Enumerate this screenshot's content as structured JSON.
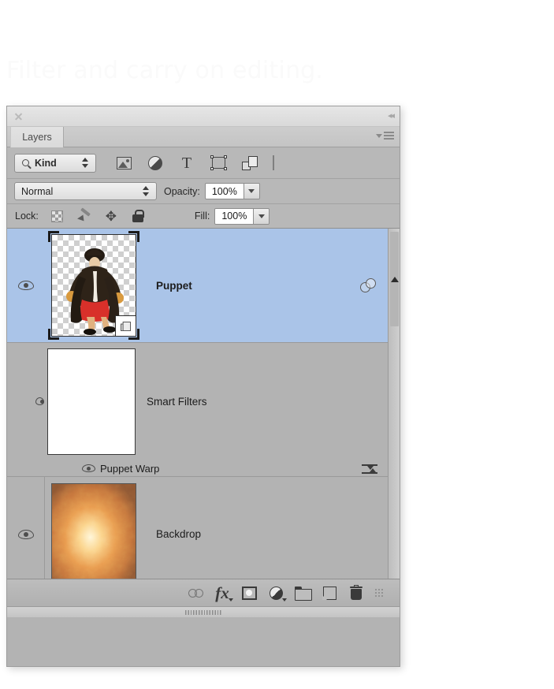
{
  "background_caption": "Filter and carry on editing.",
  "panel": {
    "tab_label": "Layers",
    "titlebar": {
      "close_icon": "close-icon",
      "collapse_icon": "collapse-to-icons-arrows"
    },
    "menu_icon": "panel-menu-icon"
  },
  "filter_bar": {
    "kind_label": "Kind",
    "search_icon": "magnifier-icon",
    "filters": [
      {
        "name": "filter-pixel-layers",
        "icon": "pixel-layer-icon"
      },
      {
        "name": "filter-adjustment-layers",
        "icon": "adjustment-layer-icon"
      },
      {
        "name": "filter-type-layers",
        "icon": "type-layer-icon",
        "glyph": "T"
      },
      {
        "name": "filter-shape-layers",
        "icon": "shape-layer-icon"
      },
      {
        "name": "filter-smart-objects",
        "icon": "smart-object-icon"
      }
    ],
    "toggle_name": "filter-enable-toggle"
  },
  "blend_bar": {
    "blend_mode": "Normal",
    "opacity_label": "Opacity:",
    "opacity_value": "100%"
  },
  "lock_bar": {
    "lock_label": "Lock:",
    "locks": [
      {
        "name": "lock-transparent-pixels",
        "icon": "checkerboard-icon"
      },
      {
        "name": "lock-image-pixels",
        "icon": "brush-icon"
      },
      {
        "name": "lock-position",
        "icon": "move-arrows-icon"
      },
      {
        "name": "lock-all",
        "icon": "lock-icon"
      }
    ],
    "fill_label": "Fill:",
    "fill_value": "100%"
  },
  "layers": [
    {
      "name": "Puppet",
      "selected": true,
      "visible": true,
      "thumbnail": "puppet-character-on-transparent",
      "smart_object_badge": true,
      "smart_filter_icon": "blending-options-icon"
    },
    {
      "name": "Backdrop",
      "selected": false,
      "visible": true,
      "thumbnail": "orange-clouds",
      "smart_object_badge": false
    }
  ],
  "smart_filters": {
    "label": "Smart Filters",
    "visible": true,
    "mask_thumbnail": "white-filter-mask",
    "entries": [
      {
        "label": "Puppet Warp",
        "visible": true,
        "options_icon": "filter-blending-options-icon"
      }
    ]
  },
  "bottom_bar": [
    {
      "name": "link-layers-button",
      "icon": "link-icon"
    },
    {
      "name": "layer-style-button",
      "icon": "fx-icon",
      "glyph": "fx"
    },
    {
      "name": "add-layer-mask-button",
      "icon": "mask-icon"
    },
    {
      "name": "new-adjustment-layer-button",
      "icon": "adjustment-half-circle-icon"
    },
    {
      "name": "new-group-button",
      "icon": "folder-icon"
    },
    {
      "name": "new-layer-button",
      "icon": "new-layer-icon"
    },
    {
      "name": "delete-layer-button",
      "icon": "trash-icon"
    },
    {
      "name": "panel-resize-grip",
      "icon": "grip-dots-icon"
    }
  ],
  "colors": {
    "panel_bg": "#b3b3b3",
    "selection_blue": "#aac4e8",
    "chrome_light": "#e6e6e6",
    "text_dark": "#1c1c1c"
  }
}
